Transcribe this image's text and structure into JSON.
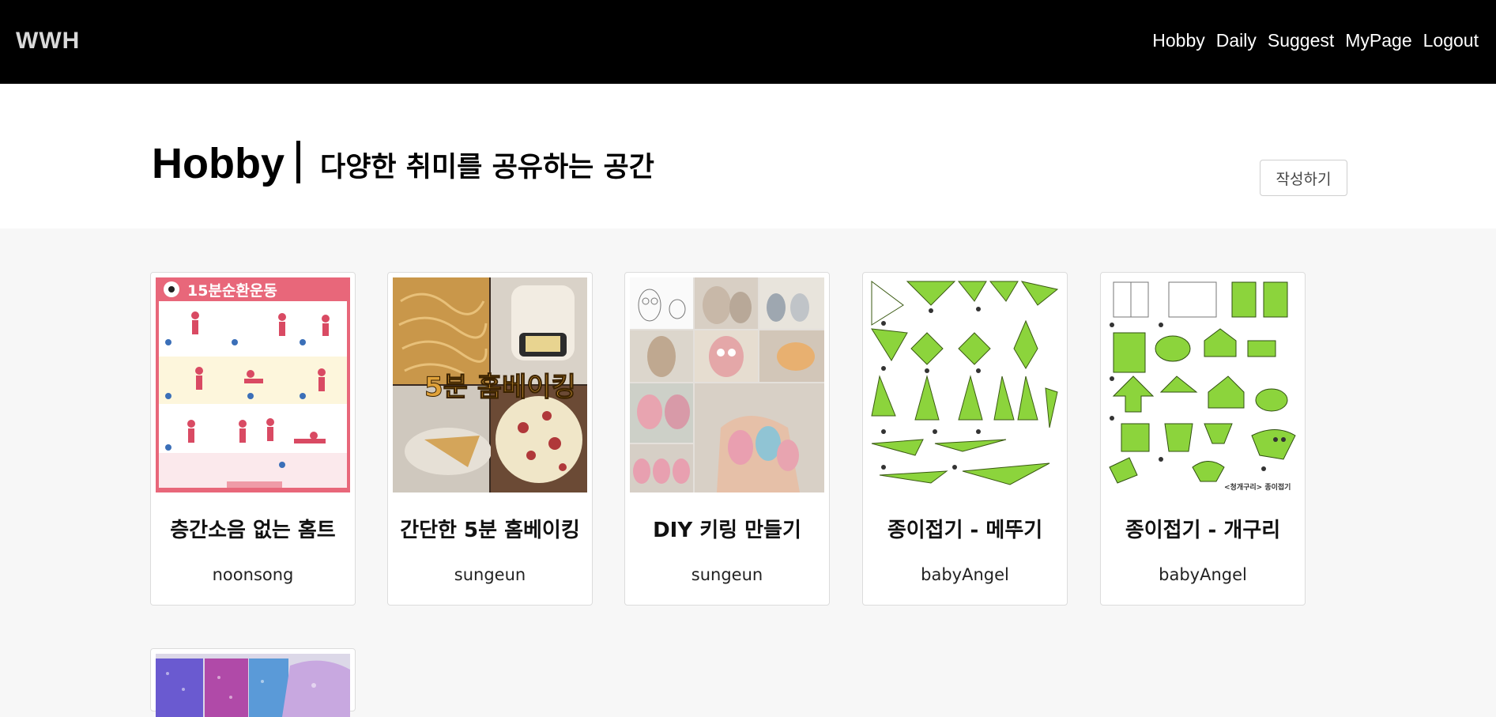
{
  "nav": {
    "brand": "WWH",
    "links": [
      "Hobby",
      "Daily",
      "Suggest",
      "MyPage",
      "Logout"
    ]
  },
  "header": {
    "title": "Hobby",
    "subtitle": "다양한 취미를 공유하는 공간",
    "write_button": "작성하기"
  },
  "posts": [
    {
      "title": "층간소음 없는 홈트",
      "author": "noonsong",
      "image": "home-workout-poster",
      "image_text": "15분순환운동"
    },
    {
      "title": "간단한 5분 홈베이킹",
      "author": "sungeun",
      "image": "home-baking-collage",
      "image_text": "5분 홈베이킹"
    },
    {
      "title": "DIY 키링 만들기",
      "author": "sungeun",
      "image": "owl-keyring-collage"
    },
    {
      "title": "종이접기 - 메뚜기",
      "author": "babyAngel",
      "image": "origami-grasshopper-diagram"
    },
    {
      "title": "종이접기 - 개구리",
      "author": "babyAngel",
      "image": "origami-frog-diagram",
      "image_text": "<청개구리> 종이접기"
    },
    {
      "title": "",
      "author": "",
      "image": "glitter-slime-photo"
    }
  ],
  "colors": {
    "navbar_bg": "#000000",
    "page_bg": "#f7f7f7",
    "origami_green": "#8cd43c",
    "poster_red": "#e05a6a"
  }
}
